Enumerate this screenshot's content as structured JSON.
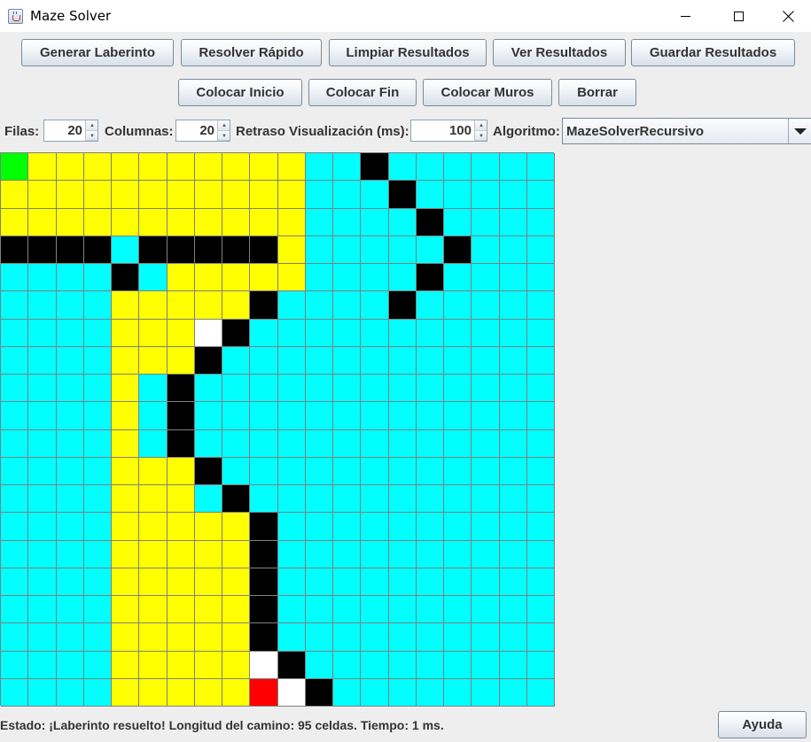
{
  "window": {
    "title": "Maze Solver",
    "icon": "java-cup-icon"
  },
  "toolbar_row1": [
    "Generar Laberinto",
    "Resolver Rápido",
    "Limpiar Resultados",
    "Ver Resultados",
    "Guardar Resultados"
  ],
  "toolbar_row2": [
    "Colocar Inicio",
    "Colocar Fin",
    "Colocar Muros",
    "Borrar"
  ],
  "controls": {
    "filas_label": "Filas:",
    "filas_value": "20",
    "columnas_label": "Columnas:",
    "columnas_value": "20",
    "retraso_label": "Retraso Visualización (ms):",
    "retraso_value": "100",
    "algoritmo_label": "Algoritmo:",
    "algoritmo_value": "MazeSolverRecursivo"
  },
  "colors": {
    "empty": "#00ffff",
    "visited": "#ffff00",
    "wall": "#000000",
    "start": "#00ff00",
    "end": "#ff0000",
    "path": "#ffffff",
    "gridline": "#808080"
  },
  "maze": {
    "rows": 20,
    "cols": 20,
    "legend": "E=empty Y=visited W=wall S=start X=end P=path",
    "cells": [
      "SYYYYYYYYYYEEWEEEEEE",
      "YYYYYYYYYYYEEEWEEEEE",
      "YYYYYYYYYYYEEEEWEEEE",
      "WWWWEWWWWWYEEEEEWEEE",
      "EEEEWEYYYYYEEEEWEEEE",
      "EEEEYYYYYWEEEEWEEEEE",
      "EEEEYYYPWEEEEEEEEEEE",
      "EEEEYYYWEEEEEEEEEEEE",
      "EEEEYEWEEEEEEEEEEEEE",
      "EEEEYEWEEEEEEEEEEEEE",
      "EEEEYEWEEEEEEEEEEEEE",
      "EEEEYYYWEEEEEEEEEEEE",
      "EEEEYYYEWEEEEEEEEEEE",
      "EEEEYYYYYWEEEEEEEEEE",
      "EEEEYYYYYWEEEEEEEEEE",
      "EEEEYYYYYWEEEEEEEEEE",
      "EEEEYYYYYWEEEEEEEEEE",
      "EEEEYYYYYWEEEEEEEEEE",
      "EEEEYYYYYPWEEEEEEEEE",
      "EEEEYYYYYXPWEEEEEEEE"
    ]
  },
  "status": "Estado: ¡Laberinto resuelto! Longitud del camino: 95 celdas. Tiempo: 1 ms.",
  "help_button": "Ayuda"
}
